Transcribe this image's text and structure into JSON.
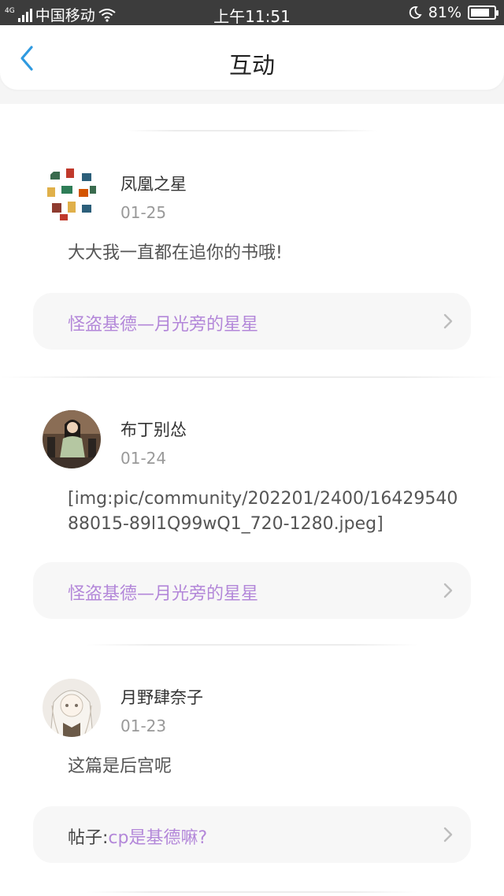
{
  "status_bar": {
    "network_type": "4G",
    "carrier": "中国移动",
    "time": "上午11:51",
    "battery_percent": "81%",
    "battery_level": 0.81
  },
  "header": {
    "title": "互动",
    "back_icon": "chevron-left-icon",
    "accent_color": "#2f9ae0"
  },
  "interactions": [
    {
      "username": "凤凰之星",
      "date": "01-25",
      "content": "大大我一直都在追你的书哦!",
      "link_prefix": "",
      "link_title": "怪盗基德—月光旁的星星"
    },
    {
      "username": "布丁别怂",
      "date": "01-24",
      "content": "[img:pic/community/202201/2400/1642954088015-89l1Q99wQ1_720-1280.jpeg]",
      "link_prefix": "",
      "link_title": "怪盗基德—月光旁的星星"
    },
    {
      "username": "月野肆奈子",
      "date": "01-23",
      "content": "这篇是后宫呢",
      "link_prefix": "帖子:",
      "link_title": "cp是基德嘛?"
    }
  ],
  "colors": {
    "link": "#b387d9",
    "date": "#999999",
    "background": "#f5f5f5"
  }
}
